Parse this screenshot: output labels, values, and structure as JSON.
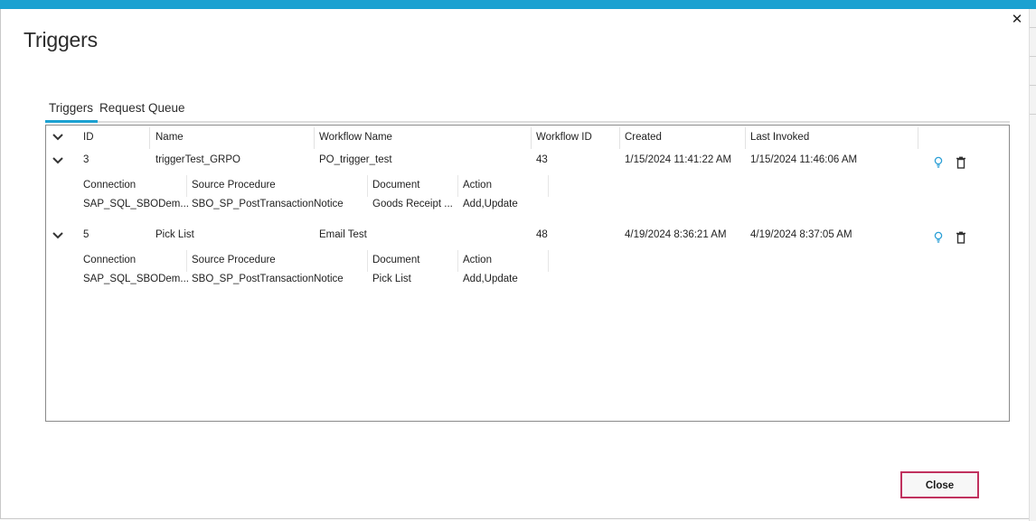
{
  "dialog": {
    "title": "Triggers",
    "close_glyph": "✕",
    "close_button_label": "Close"
  },
  "tabs": [
    {
      "label": "Triggers",
      "active": true
    },
    {
      "label": "Request Queue",
      "active": false
    }
  ],
  "grid": {
    "columns": [
      "ID",
      "Name",
      "Workflow Name",
      "Workflow ID",
      "Created",
      "Last Invoked"
    ],
    "detail_columns": [
      "Connection",
      "Source Procedure",
      "Document",
      "Action"
    ],
    "rows": [
      {
        "id": "3",
        "name": "triggerTest_GRPO",
        "workflow_name": "PO_trigger_test",
        "workflow_id": "43",
        "created": "1/15/2024 11:41:22 AM",
        "last_invoked": "1/15/2024 11:46:06 AM",
        "detail": {
          "connection": "SAP_SQL_SBODem...",
          "source_procedure": "SBO_SP_PostTransactionNotice",
          "document": "Goods Receipt ...",
          "action": "Add,Update"
        }
      },
      {
        "id": "5",
        "name": "Pick List",
        "workflow_name": "Email Test",
        "workflow_id": "48",
        "created": "4/19/2024 8:36:21 AM",
        "last_invoked": "4/19/2024 8:37:05 AM",
        "detail": {
          "connection": "SAP_SQL_SBODem...",
          "source_procedure": "SBO_SP_PostTransactionNotice",
          "document": "Pick List",
          "action": "Add,Update"
        }
      }
    ]
  },
  "icons": {
    "expand": "chevron-down-icon",
    "bulb": "lightbulb-icon",
    "delete": "trash-icon",
    "close": "close-icon"
  },
  "colors": {
    "accent": "#1ba1d1",
    "close_button_border": "#c0315e",
    "bulb": "#2a9fd6"
  }
}
